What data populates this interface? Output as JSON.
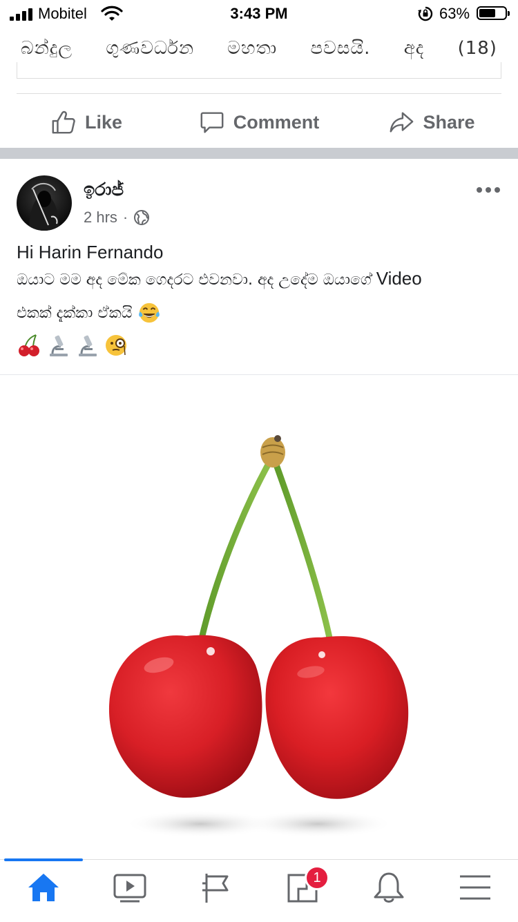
{
  "status_bar": {
    "carrier": "Mobitel",
    "time": "3:43 PM",
    "battery_percent": "63%",
    "battery_level": 0.63
  },
  "previous_post": {
    "words": [
      "බන්දුල",
      "ගුණවර්ධන",
      "මහතා",
      "පවසයි.",
      "අද",
      "(18)"
    ]
  },
  "actions": {
    "like": "Like",
    "comment": "Comment",
    "share": "Share"
  },
  "post": {
    "author": "ඉරාජ්",
    "time": "2 hrs",
    "dot": "·",
    "line1": "Hi Harin Fernando",
    "line2_sinhala": "ඔයාට මම අද මේක ගෙදරට එවනවා. අද උදේම ඔයාගේ ",
    "line2_latin": "Video",
    "line3": "එකක් දැක්කා ඒකයි",
    "emoji_line": [
      "cherries-icon",
      "microscope-icon",
      "microscope-icon",
      "face-with-monocle-icon"
    ],
    "photo": "cherries-photo"
  },
  "tabbar": {
    "items": [
      "home-icon",
      "video-icon",
      "pages-flag-icon",
      "marketplace-icon",
      "notifications-bell-icon",
      "menu-icon"
    ],
    "active": "home-icon",
    "badge_count": "1"
  },
  "colors": {
    "accent": "#1877f2",
    "badge": "#e41e3f",
    "secondary_text": "#65676b"
  }
}
